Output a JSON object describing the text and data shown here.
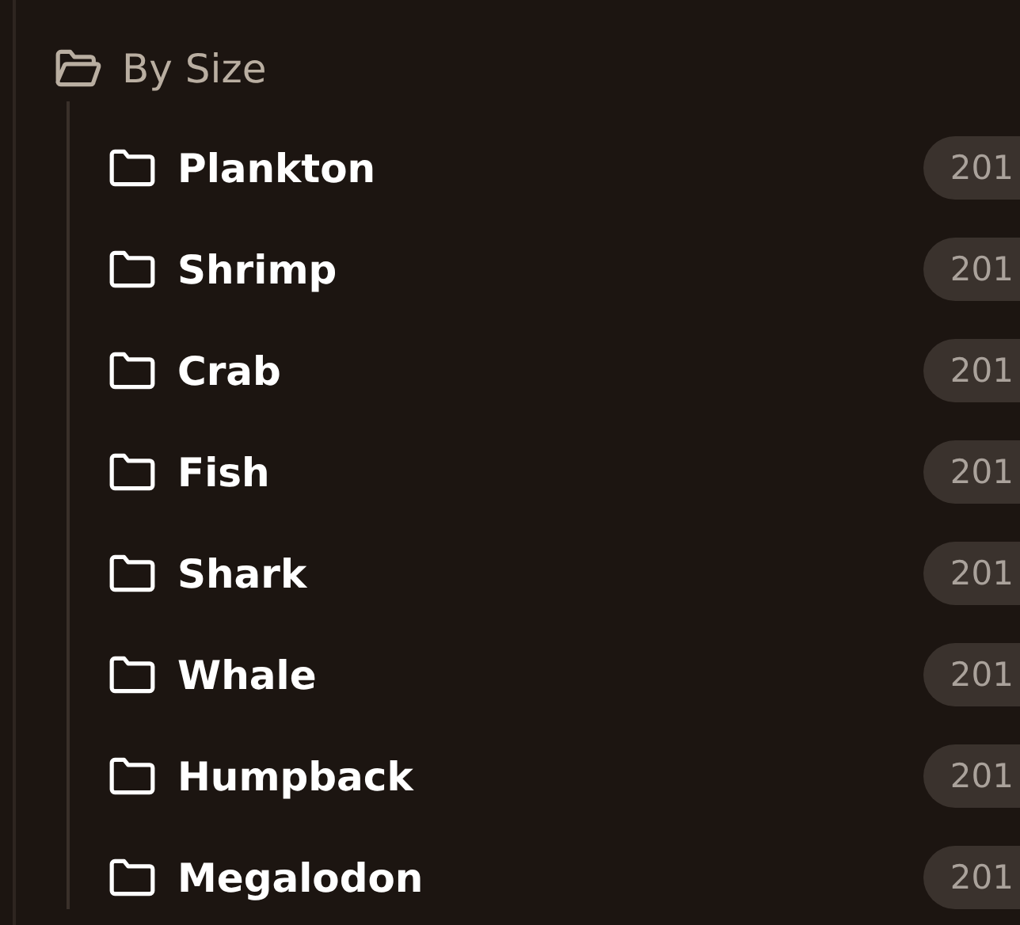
{
  "tree": [
    {
      "label": "By Size",
      "expanded": true,
      "children": [
        {
          "label": "Plankton",
          "count": "201",
          "expanded": false
        },
        {
          "label": "Shrimp",
          "count": "201",
          "expanded": false
        },
        {
          "label": "Crab",
          "count": "201",
          "expanded": false
        },
        {
          "label": "Fish",
          "count": "201",
          "expanded": false
        },
        {
          "label": "Shark",
          "count": "201",
          "expanded": false
        },
        {
          "label": "Whale",
          "count": "201",
          "expanded": false
        },
        {
          "label": "Humpback",
          "count": "201",
          "expanded": false
        },
        {
          "label": "Megalodon",
          "count": "201",
          "expanded": false
        }
      ]
    }
  ]
}
